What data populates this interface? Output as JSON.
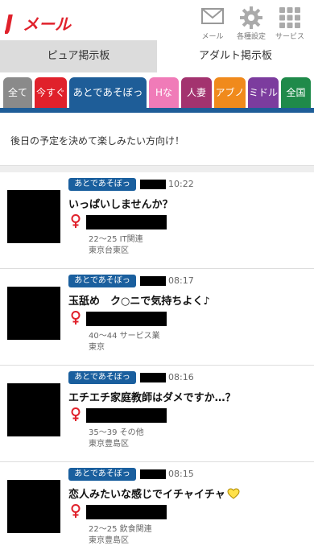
{
  "header": {
    "logo_text": "Jメール",
    "icons": [
      {
        "name": "mail-icon",
        "label": "メール"
      },
      {
        "name": "gear-icon",
        "label": "各種設定"
      },
      {
        "name": "grid-icon",
        "label": "サービス"
      }
    ]
  },
  "boards": {
    "pure_label": "ピュア掲示板",
    "adult_label": "アダルト掲示板"
  },
  "categories": [
    {
      "label": "全て",
      "color": "#8a8a8a"
    },
    {
      "label": "今すぐ",
      "color": "#e0212b"
    },
    {
      "label": "あとであそぼっ",
      "color": "#1e5d98"
    },
    {
      "label": "Hな",
      "color": "#f07bb8"
    },
    {
      "label": "人妻",
      "color": "#a3336f"
    },
    {
      "label": "アブノ",
      "color": "#f08a1c"
    },
    {
      "label": "ミドル",
      "color": "#7c3c9e"
    },
    {
      "label": "全国",
      "color": "#1f8a4a"
    }
  ],
  "info": {
    "description": "後日の予定を決めて楽しみたい方向け！"
  },
  "posts": [
    {
      "badge": "あとであそぼっ",
      "time": "10:22",
      "title": "いっぱいしませんか？",
      "age_job": "22～25 IT関連",
      "area": "東京台東区",
      "heart": false
    },
    {
      "badge": "あとであそぼっ",
      "time": "08:17",
      "title": "玉舐め　ク○ニで気持ちよく♪",
      "age_job": "40～44 サービス業",
      "area": "東京",
      "heart": false
    },
    {
      "badge": "あとであそぼっ",
      "time": "08:16",
      "title": "エチエチ家庭教師はダメですか…？",
      "age_job": "35～39 その他",
      "area": "東京豊島区",
      "heart": false
    },
    {
      "badge": "あとであそぼっ",
      "time": "08:15",
      "title": "恋人みたいな感じでイチャイチャ",
      "age_job": "22～25 飲食関連",
      "area": "東京豊島区",
      "heart": true
    }
  ],
  "colors": {
    "brand_red": "#e0212b",
    "category_blue": "#1e5d98",
    "female_symbol": "#e0212b"
  }
}
